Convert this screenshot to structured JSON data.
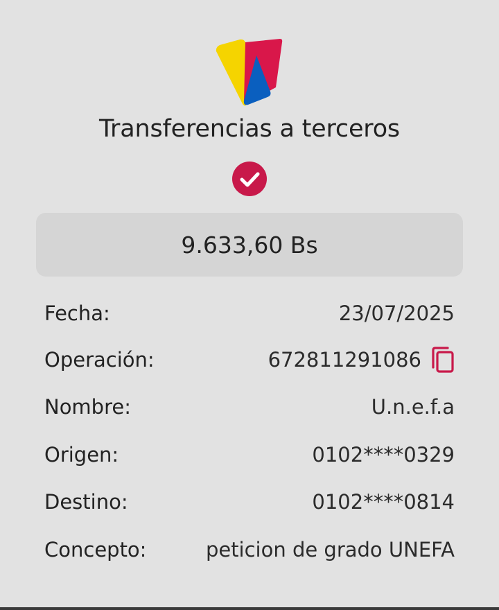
{
  "header": {
    "logo_icon": "bank-logo-icon",
    "title": "Transferencias a terceros",
    "status_icon": "check-circle-icon"
  },
  "amount": "9.633,60 Bs",
  "details": [
    {
      "label": "Fecha:",
      "value": "23/07/2025"
    },
    {
      "label": "Operación:",
      "value": "672811291086",
      "action_icon": "copy-icon"
    },
    {
      "label": "Nombre:",
      "value": "U.n.e.f.a"
    },
    {
      "label": "Origen:",
      "value": "0102****0329"
    },
    {
      "label": "Destino:",
      "value": "0102****0814"
    },
    {
      "label": "Concepto:",
      "value": "peticion de grado UNEFA"
    }
  ],
  "colors": {
    "background": "#e2e2e2",
    "accent": "#c8194a",
    "logo_yellow": "#f5d400",
    "logo_blue": "#0a5fbf",
    "logo_red": "#d9174a"
  }
}
